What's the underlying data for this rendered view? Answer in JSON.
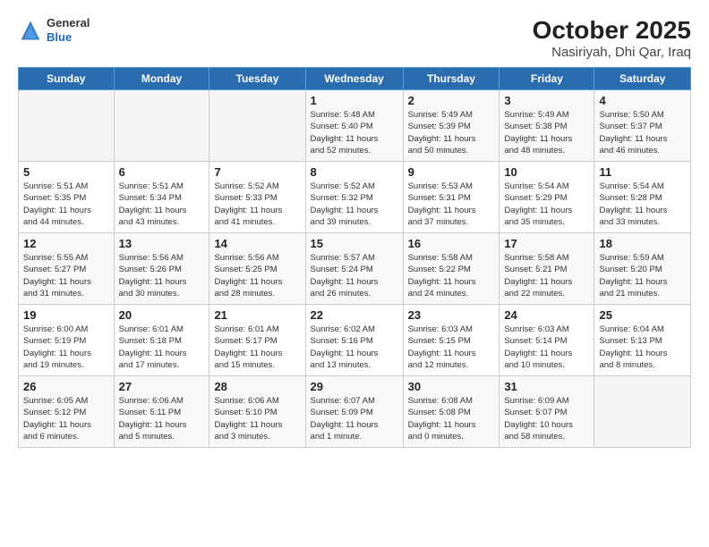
{
  "header": {
    "logo": {
      "general": "General",
      "blue": "Blue"
    },
    "title": "October 2025",
    "subtitle": "Nasiriyah, Dhi Qar, Iraq"
  },
  "calendar": {
    "days_of_week": [
      "Sunday",
      "Monday",
      "Tuesday",
      "Wednesday",
      "Thursday",
      "Friday",
      "Saturday"
    ],
    "weeks": [
      [
        {
          "day": "",
          "info": ""
        },
        {
          "day": "",
          "info": ""
        },
        {
          "day": "",
          "info": ""
        },
        {
          "day": "1",
          "info": "Sunrise: 5:48 AM\nSunset: 5:40 PM\nDaylight: 11 hours\nand 52 minutes."
        },
        {
          "day": "2",
          "info": "Sunrise: 5:49 AM\nSunset: 5:39 PM\nDaylight: 11 hours\nand 50 minutes."
        },
        {
          "day": "3",
          "info": "Sunrise: 5:49 AM\nSunset: 5:38 PM\nDaylight: 11 hours\nand 48 minutes."
        },
        {
          "day": "4",
          "info": "Sunrise: 5:50 AM\nSunset: 5:37 PM\nDaylight: 11 hours\nand 46 minutes."
        }
      ],
      [
        {
          "day": "5",
          "info": "Sunrise: 5:51 AM\nSunset: 5:35 PM\nDaylight: 11 hours\nand 44 minutes."
        },
        {
          "day": "6",
          "info": "Sunrise: 5:51 AM\nSunset: 5:34 PM\nDaylight: 11 hours\nand 43 minutes."
        },
        {
          "day": "7",
          "info": "Sunrise: 5:52 AM\nSunset: 5:33 PM\nDaylight: 11 hours\nand 41 minutes."
        },
        {
          "day": "8",
          "info": "Sunrise: 5:52 AM\nSunset: 5:32 PM\nDaylight: 11 hours\nand 39 minutes."
        },
        {
          "day": "9",
          "info": "Sunrise: 5:53 AM\nSunset: 5:31 PM\nDaylight: 11 hours\nand 37 minutes."
        },
        {
          "day": "10",
          "info": "Sunrise: 5:54 AM\nSunset: 5:29 PM\nDaylight: 11 hours\nand 35 minutes."
        },
        {
          "day": "11",
          "info": "Sunrise: 5:54 AM\nSunset: 5:28 PM\nDaylight: 11 hours\nand 33 minutes."
        }
      ],
      [
        {
          "day": "12",
          "info": "Sunrise: 5:55 AM\nSunset: 5:27 PM\nDaylight: 11 hours\nand 31 minutes."
        },
        {
          "day": "13",
          "info": "Sunrise: 5:56 AM\nSunset: 5:26 PM\nDaylight: 11 hours\nand 30 minutes."
        },
        {
          "day": "14",
          "info": "Sunrise: 5:56 AM\nSunset: 5:25 PM\nDaylight: 11 hours\nand 28 minutes."
        },
        {
          "day": "15",
          "info": "Sunrise: 5:57 AM\nSunset: 5:24 PM\nDaylight: 11 hours\nand 26 minutes."
        },
        {
          "day": "16",
          "info": "Sunrise: 5:58 AM\nSunset: 5:22 PM\nDaylight: 11 hours\nand 24 minutes."
        },
        {
          "day": "17",
          "info": "Sunrise: 5:58 AM\nSunset: 5:21 PM\nDaylight: 11 hours\nand 22 minutes."
        },
        {
          "day": "18",
          "info": "Sunrise: 5:59 AM\nSunset: 5:20 PM\nDaylight: 11 hours\nand 21 minutes."
        }
      ],
      [
        {
          "day": "19",
          "info": "Sunrise: 6:00 AM\nSunset: 5:19 PM\nDaylight: 11 hours\nand 19 minutes."
        },
        {
          "day": "20",
          "info": "Sunrise: 6:01 AM\nSunset: 5:18 PM\nDaylight: 11 hours\nand 17 minutes."
        },
        {
          "day": "21",
          "info": "Sunrise: 6:01 AM\nSunset: 5:17 PM\nDaylight: 11 hours\nand 15 minutes."
        },
        {
          "day": "22",
          "info": "Sunrise: 6:02 AM\nSunset: 5:16 PM\nDaylight: 11 hours\nand 13 minutes."
        },
        {
          "day": "23",
          "info": "Sunrise: 6:03 AM\nSunset: 5:15 PM\nDaylight: 11 hours\nand 12 minutes."
        },
        {
          "day": "24",
          "info": "Sunrise: 6:03 AM\nSunset: 5:14 PM\nDaylight: 11 hours\nand 10 minutes."
        },
        {
          "day": "25",
          "info": "Sunrise: 6:04 AM\nSunset: 5:13 PM\nDaylight: 11 hours\nand 8 minutes."
        }
      ],
      [
        {
          "day": "26",
          "info": "Sunrise: 6:05 AM\nSunset: 5:12 PM\nDaylight: 11 hours\nand 6 minutes."
        },
        {
          "day": "27",
          "info": "Sunrise: 6:06 AM\nSunset: 5:11 PM\nDaylight: 11 hours\nand 5 minutes."
        },
        {
          "day": "28",
          "info": "Sunrise: 6:06 AM\nSunset: 5:10 PM\nDaylight: 11 hours\nand 3 minutes."
        },
        {
          "day": "29",
          "info": "Sunrise: 6:07 AM\nSunset: 5:09 PM\nDaylight: 11 hours\nand 1 minute."
        },
        {
          "day": "30",
          "info": "Sunrise: 6:08 AM\nSunset: 5:08 PM\nDaylight: 11 hours\nand 0 minutes."
        },
        {
          "day": "31",
          "info": "Sunrise: 6:09 AM\nSunset: 5:07 PM\nDaylight: 10 hours\nand 58 minutes."
        },
        {
          "day": "",
          "info": ""
        }
      ]
    ]
  }
}
